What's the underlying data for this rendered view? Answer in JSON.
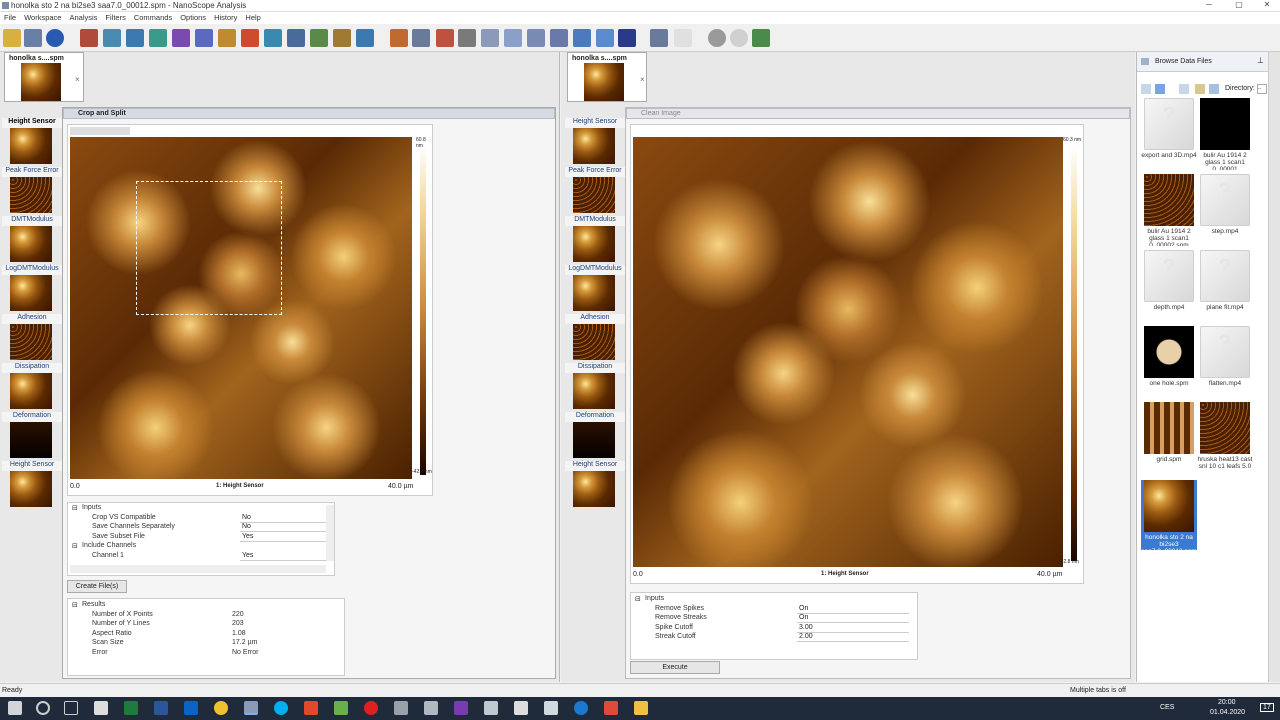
{
  "window": {
    "title": "honolka sto 2 na bi2se3 saa7.0_00012.spm - NanoScope Analysis"
  },
  "menu": [
    "File",
    "Workspace",
    "Analysis",
    "Filters",
    "Commands",
    "Options",
    "History",
    "Help"
  ],
  "left_doc_tab": {
    "label": "honolka s....spm"
  },
  "right_doc_tab": {
    "label": "honolka s....spm"
  },
  "channels_left": [
    "Height Sensor",
    "Peak Force Error",
    "DMTModulus",
    "LogDMTModulus",
    "Adhesion",
    "Dissipation",
    "Deformation",
    "Height Sensor"
  ],
  "channels_right": [
    "Height Sensor",
    "Peak Force Error",
    "DMTModulus",
    "LogDMTModulus",
    "Adhesion",
    "Dissipation",
    "Deformation",
    "Height Sensor"
  ],
  "crop_panel": {
    "title": "Crop and Split",
    "scale_top": "60.8 nm",
    "scale_bottom": "-42.7 nm",
    "axis_left": "0.0",
    "axis_right": "40.0 µm",
    "channel_caption": "1: Height Sensor",
    "inputs_header": "Inputs",
    "inputs": [
      {
        "label": "Crop VS Compatible",
        "value": "No"
      },
      {
        "label": "Save Channels Separately",
        "value": "No"
      },
      {
        "label": "Save Subset File",
        "value": "Yes"
      }
    ],
    "include_channels_header": "Include Channels",
    "channel_rows": [
      {
        "label": "Channel 1",
        "value": "Yes"
      }
    ],
    "create_button": "Create File(s)",
    "results_header": "Results",
    "results": [
      {
        "label": "Number of X Points",
        "value": "220"
      },
      {
        "label": "Number of Y Lines",
        "value": "203"
      },
      {
        "label": "Aspect Ratio",
        "value": "1.08"
      },
      {
        "label": "Scan Size",
        "value": "17.2 µm"
      },
      {
        "label": "Error",
        "value": "No Error"
      }
    ]
  },
  "clean_panel": {
    "title": "Clean Image",
    "scale_top": "60.3 nm",
    "scale_bottom": "-42.8 nm",
    "axis_left": "0.0",
    "axis_right": "40.0 µm",
    "channel_caption": "1: Height Sensor",
    "inputs_header": "Inputs",
    "inputs": [
      {
        "label": "Remove Spikes",
        "value": "On"
      },
      {
        "label": "Remove Streaks",
        "value": "On"
      },
      {
        "label": "Spike Cutoff",
        "value": "3.00"
      },
      {
        "label": "Streak Cutoff",
        "value": "2.00"
      }
    ],
    "execute_button": "Execute"
  },
  "browser": {
    "title": "Browse Data Files",
    "directory_label": "Directory:",
    "files": [
      {
        "name": "export and 3D.mp4",
        "kind": "doc"
      },
      {
        "name": "bulir Au 1914 2 glass 1 scan1 0_00001",
        "kind": "black"
      },
      {
        "name": "bulir Au 1914 2 glass 1 scan1 0_00002.spm",
        "kind": "speckle"
      },
      {
        "name": "step.mp4",
        "kind": "doc"
      },
      {
        "name": "depth.mp4",
        "kind": "doc"
      },
      {
        "name": "plane fit.mp4",
        "kind": "doc"
      },
      {
        "name": "one hole.spm",
        "kind": "hole"
      },
      {
        "name": "flatten.mp4",
        "kind": "doc"
      },
      {
        "name": "grid.spm",
        "kind": "grid"
      },
      {
        "name": "hruska heat13 cast snl 10 c1 leafs 5.0",
        "kind": "speckle"
      },
      {
        "name": "honolka sto 2 na bi2se3 saa7.0_00012.spm",
        "kind": "afm"
      }
    ]
  },
  "status": {
    "left": "Ready",
    "right": "Multiple tabs is off"
  },
  "taskbar": {
    "lang": "CES",
    "time": "20:00",
    "date": "01.04.2020",
    "notif": "17"
  }
}
